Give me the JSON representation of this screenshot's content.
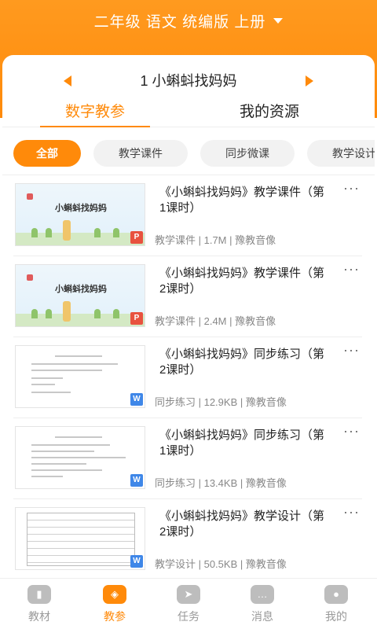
{
  "header": {
    "title": "二年级 语文 统编版 上册"
  },
  "lesson": {
    "title": "1 小蝌蚪找妈妈"
  },
  "tabs": [
    {
      "label": "数字教参"
    },
    {
      "label": "我的资源"
    }
  ],
  "filters": [
    {
      "label": "全部"
    },
    {
      "label": "教学课件"
    },
    {
      "label": "同步微课"
    },
    {
      "label": "教学设计"
    }
  ],
  "items": [
    {
      "title": "《小蝌蚪找妈妈》教学课件（第1课时）",
      "meta": "教学课件 | 1.7M | 豫教音像",
      "thumb_text": "小蝌蚪找妈妈",
      "badge": "P"
    },
    {
      "title": "《小蝌蚪找妈妈》教学课件（第2课时）",
      "meta": "教学课件 | 2.4M | 豫教音像",
      "thumb_text": "小蝌蚪找妈妈",
      "badge": "P"
    },
    {
      "title": "《小蝌蚪找妈妈》同步练习（第2课时）",
      "meta": "同步练习 | 12.9KB | 豫教音像",
      "badge": "W"
    },
    {
      "title": "《小蝌蚪找妈妈》同步练习（第1课时）",
      "meta": "同步练习 | 13.4KB | 豫教音像",
      "badge": "W"
    },
    {
      "title": "《小蝌蚪找妈妈》教学设计（第2课时）",
      "meta": "教学设计 | 50.5KB | 豫教音像",
      "badge": "W"
    }
  ],
  "more_glyph": "···",
  "bottom_nav": [
    {
      "label": "教材",
      "icon": "book-icon"
    },
    {
      "label": "教参",
      "icon": "layers-icon"
    },
    {
      "label": "任务",
      "icon": "send-icon"
    },
    {
      "label": "消息",
      "icon": "chat-icon"
    },
    {
      "label": "我的",
      "icon": "user-icon"
    }
  ],
  "colors": {
    "accent": "#ff8a0a",
    "text": "#222222",
    "muted": "#888888"
  }
}
